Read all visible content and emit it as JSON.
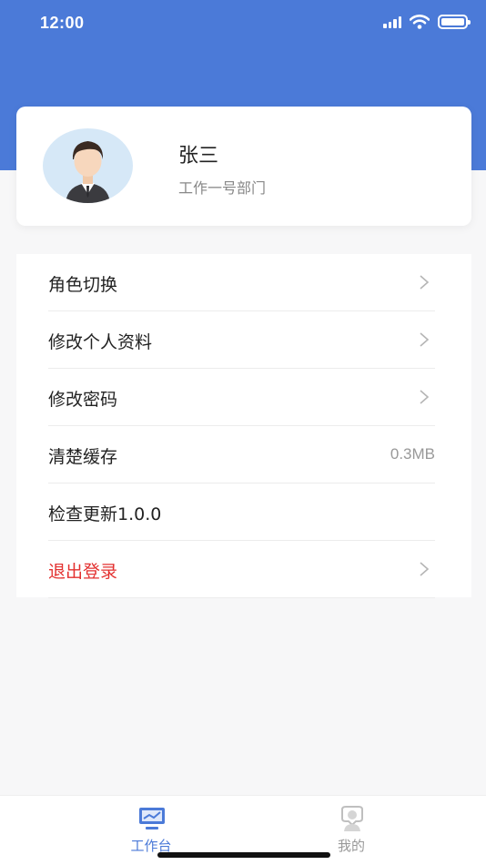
{
  "status_bar": {
    "time": "12:00"
  },
  "profile": {
    "name": "张三",
    "department": "工作一号部门"
  },
  "menu": {
    "role_switch": {
      "label": "角色切换"
    },
    "edit_profile": {
      "label": "修改个人资料"
    },
    "change_password": {
      "label": "修改密码"
    },
    "clear_cache": {
      "label": "清楚缓存",
      "value": "0.3MB"
    },
    "check_update": {
      "label": "检查更新1.0.0"
    },
    "logout": {
      "label": "退出登录"
    }
  },
  "tabbar": {
    "workbench": {
      "label": "工作台",
      "icon": "monitor-icon",
      "active": true
    },
    "mine": {
      "label": "我的",
      "icon": "person-icon",
      "active": false
    }
  },
  "colors": {
    "primary": "#4b7ad8",
    "danger": "#e3302f",
    "background": "#f7f7f8"
  }
}
